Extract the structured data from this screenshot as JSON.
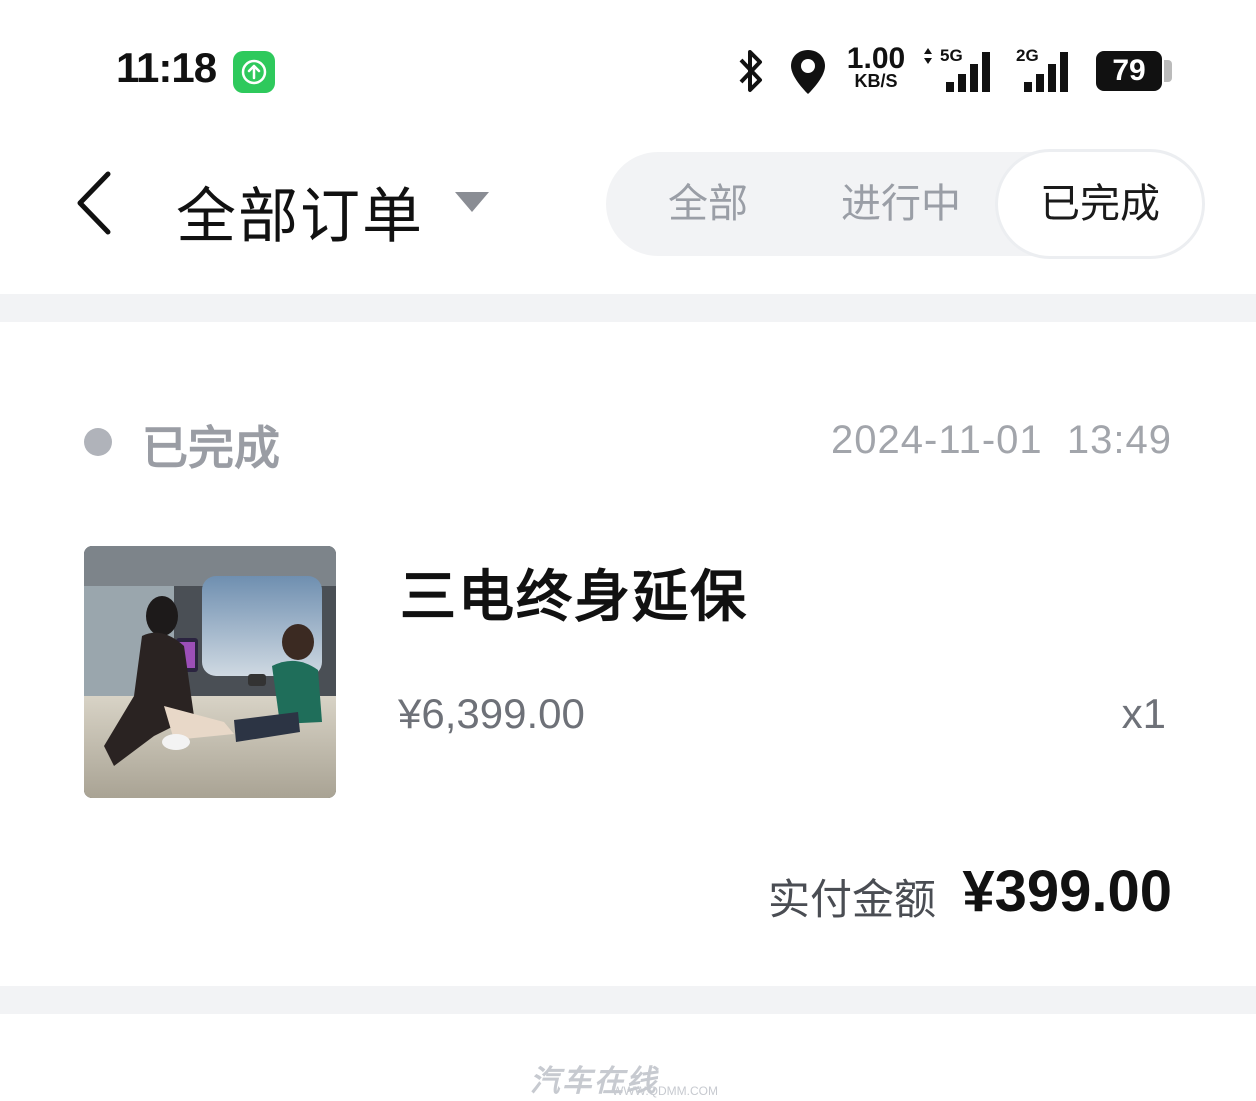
{
  "status_bar": {
    "time": "11:18",
    "upload_icon": "upload-arrow-icon",
    "network_speed_value": "1.00",
    "network_speed_unit": "KB/S",
    "sim1_type": "5G",
    "sim2_type": "2G",
    "battery_percent": "79",
    "colors": {
      "upload_badge": "#2ec95c"
    }
  },
  "header": {
    "back_icon": "chevron-left-icon",
    "title": "全部订单",
    "dropdown_icon": "caret-down-icon",
    "tabs": [
      {
        "label": "全部",
        "active": false
      },
      {
        "label": "进行中",
        "active": false
      },
      {
        "label": "已完成",
        "active": true
      }
    ]
  },
  "orders": [
    {
      "status": "已完成",
      "datetime": "2024-11-01  13:49",
      "product_name": "三电终身延保",
      "unit_price": "¥6,399.00",
      "quantity": "x1",
      "paid_label": "实付金额",
      "paid_amount": "¥399.00"
    }
  ],
  "watermark": {
    "text": "汽车在线",
    "url": "WWW.QDMM.COM"
  }
}
